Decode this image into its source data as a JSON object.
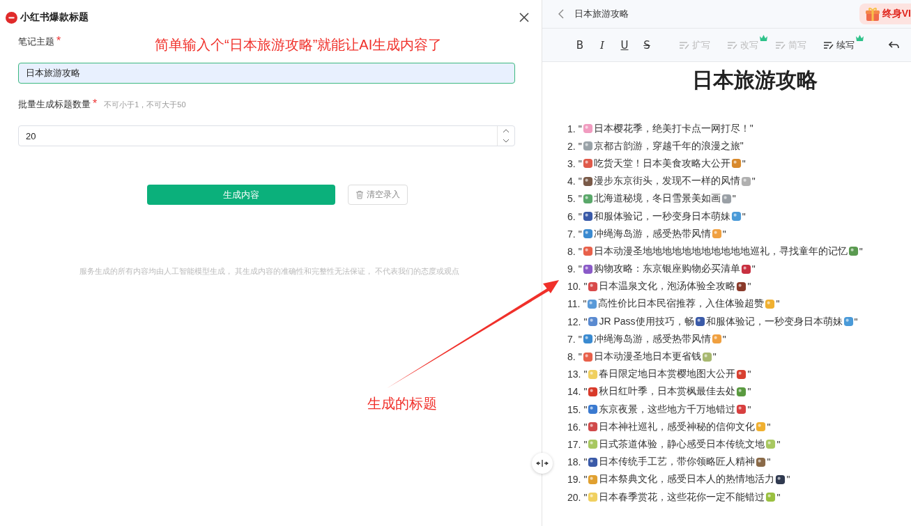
{
  "form_panel": {
    "title": "小红书爆款标题",
    "fields": [
      {
        "kind": "text",
        "label": "笔记主题",
        "required_mark": "*",
        "value": "日本旅游攻略",
        "focused": true
      },
      {
        "kind": "number",
        "label": "批量生成标题数量",
        "required_mark": "*",
        "hint": "不可小于1，不可大于50",
        "value": "20",
        "focused": false
      }
    ],
    "primary_button": "生成内容",
    "clear_button": "清空录入",
    "disclaimer": "服务生成的所有内容均由人工智能模型生成， 其生成内容的准确性和完整性无法保证， 不代表我们的态度或观点"
  },
  "annotations": [
    {
      "kind": "top",
      "text": "简单输入个“日本旅游攻略”就能让AI生成内容了"
    },
    {
      "kind": "bottom",
      "text": "生成的标题"
    }
  ],
  "editor": {
    "breadcrumb": "日本旅游攻略",
    "vip_button": "终身VI",
    "format_buttons": [
      {
        "kind": "bold",
        "label": "B"
      },
      {
        "kind": "italic",
        "label": "I"
      },
      {
        "kind": "underline",
        "label": "U"
      },
      {
        "kind": "strike",
        "label": "S"
      }
    ],
    "ai_tools": [
      {
        "label": "扩写",
        "disabled": true,
        "vip": false
      },
      {
        "label": "改写",
        "disabled": true,
        "vip": true
      },
      {
        "label": "简写",
        "disabled": true,
        "vip": false
      },
      {
        "label": "续写",
        "disabled": false,
        "vip": true
      }
    ],
    "heading": "日本旅游攻略",
    "items": [
      {
        "number": "1.",
        "parts": [
          {
            "kind": "text",
            "text": "\""
          },
          {
            "kind": "emoji",
            "color": "#f19cc0"
          },
          {
            "kind": "text",
            "text": "日本樱花季，绝美打卡点一网打尽！\""
          }
        ]
      },
      {
        "number": "2.",
        "parts": [
          {
            "kind": "text",
            "text": "\""
          },
          {
            "kind": "emoji",
            "color": "#9aa3a8"
          },
          {
            "kind": "text",
            "text": "京都古韵游，穿越千年的浪漫之旅\""
          }
        ]
      },
      {
        "number": "3.",
        "parts": [
          {
            "kind": "text",
            "text": "\""
          },
          {
            "kind": "emoji",
            "color": "#e05a4a"
          },
          {
            "kind": "text",
            "text": "吃货天堂！日本美食攻略大公开"
          },
          {
            "kind": "emoji",
            "color": "#d8892c"
          },
          {
            "kind": "text",
            "text": "\""
          }
        ]
      },
      {
        "number": "4.",
        "parts": [
          {
            "kind": "text",
            "text": "\""
          },
          {
            "kind": "emoji",
            "color": "#7a5a48"
          },
          {
            "kind": "text",
            "text": "漫步东京街头，发现不一样的风情"
          },
          {
            "kind": "emoji",
            "color": "#b0b0b0"
          },
          {
            "kind": "text",
            "text": "\""
          }
        ]
      },
      {
        "number": "5.",
        "parts": [
          {
            "kind": "text",
            "text": "\""
          },
          {
            "kind": "emoji",
            "color": "#5aa86a"
          },
          {
            "kind": "text",
            "text": "北海道秘境，冬日雪景美如画"
          },
          {
            "kind": "emoji",
            "color": "#9aa0a6"
          },
          {
            "kind": "text",
            "text": "\""
          }
        ]
      },
      {
        "number": "6.",
        "parts": [
          {
            "kind": "text",
            "text": "\""
          },
          {
            "kind": "emoji",
            "color": "#3a5aa8"
          },
          {
            "kind": "text",
            "text": "和服体验记，一秒变身日本萌妹"
          },
          {
            "kind": "emoji",
            "color": "#4a9ad8"
          },
          {
            "kind": "text",
            "text": "\""
          }
        ]
      },
      {
        "number": "7.",
        "parts": [
          {
            "kind": "text",
            "text": "\""
          },
          {
            "kind": "emoji",
            "color": "#3a8ad0"
          },
          {
            "kind": "text",
            "text": "冲绳海岛游，感受热带风情"
          },
          {
            "kind": "emoji",
            "color": "#f0a040"
          },
          {
            "kind": "text",
            "text": "\""
          }
        ]
      },
      {
        "number": "8.",
        "parts": [
          {
            "kind": "text",
            "text": "\""
          },
          {
            "kind": "emoji",
            "color": "#e8604a"
          },
          {
            "kind": "text",
            "text": "日本动漫圣地地地地地地地地地地地巡礼，寻找童年的记忆"
          },
          {
            "kind": "emoji",
            "color": "#5a9a50"
          },
          {
            "kind": "text",
            "text": "\""
          }
        ]
      },
      {
        "number": "9.",
        "parts": [
          {
            "kind": "text",
            "text": "\""
          },
          {
            "kind": "emoji",
            "color": "#8a5ac8"
          },
          {
            "kind": "text",
            "text": "购物攻略：东京银座购物必买清单"
          },
          {
            "kind": "emoji",
            "color": "#c83040"
          },
          {
            "kind": "text",
            "text": "\""
          }
        ]
      },
      {
        "number": "10.",
        "parts": [
          {
            "kind": "text",
            "text": "\""
          },
          {
            "kind": "emoji",
            "color": "#d84a4a"
          },
          {
            "kind": "text",
            "text": "日本温泉文化，泡汤体验全攻略"
          },
          {
            "kind": "emoji",
            "color": "#8a3a2a"
          },
          {
            "kind": "text",
            "text": "\""
          }
        ]
      },
      {
        "number": "11.",
        "parts": [
          {
            "kind": "text",
            "text": "\""
          },
          {
            "kind": "emoji",
            "color": "#5a9ad8"
          },
          {
            "kind": "text",
            "text": "高性价比日本民宿推荐，入住体验超赞"
          },
          {
            "kind": "emoji",
            "color": "#f0b030"
          },
          {
            "kind": "text",
            "text": "\""
          }
        ]
      },
      {
        "number": "12.",
        "parts": [
          {
            "kind": "text",
            "text": "\""
          },
          {
            "kind": "emoji",
            "color": "#5a8ad0"
          },
          {
            "kind": "text",
            "text": "JR Pass使用技巧，畅"
          },
          {
            "kind": "emoji",
            "color": "#3a5aa8"
          },
          {
            "kind": "text",
            "text": "和服体验记，一秒变身日本萌妹"
          },
          {
            "kind": "emoji",
            "color": "#4a9ad8"
          },
          {
            "kind": "text",
            "text": "\""
          }
        ]
      },
      {
        "number": "7.",
        "parts": [
          {
            "kind": "text",
            "text": "\""
          },
          {
            "kind": "emoji",
            "color": "#3a8ad0"
          },
          {
            "kind": "text",
            "text": "冲绳海岛游，感受热带风情"
          },
          {
            "kind": "emoji",
            "color": "#f0a040"
          },
          {
            "kind": "text",
            "text": "\""
          }
        ]
      },
      {
        "number": "8.",
        "parts": [
          {
            "kind": "text",
            "text": "\""
          },
          {
            "kind": "emoji",
            "color": "#e8604a"
          },
          {
            "kind": "text",
            "text": "日本动漫圣地日本更省钱"
          },
          {
            "kind": "emoji",
            "color": "#a8b870"
          },
          {
            "kind": "text",
            "text": "\""
          }
        ]
      },
      {
        "number": "13.",
        "parts": [
          {
            "kind": "text",
            "text": "\""
          },
          {
            "kind": "emoji",
            "color": "#f0d060"
          },
          {
            "kind": "text",
            "text": "春日限定地日本赏樱地图大公开"
          },
          {
            "kind": "emoji",
            "color": "#d84030"
          },
          {
            "kind": "text",
            "text": "\""
          }
        ]
      },
      {
        "number": "14.",
        "parts": [
          {
            "kind": "text",
            "text": "\""
          },
          {
            "kind": "emoji",
            "color": "#d83a2a"
          },
          {
            "kind": "text",
            "text": "秋日红叶季，日本赏枫最佳去处"
          },
          {
            "kind": "emoji",
            "color": "#5a9a40"
          },
          {
            "kind": "text",
            "text": "\""
          }
        ]
      },
      {
        "number": "15.",
        "parts": [
          {
            "kind": "text",
            "text": "\""
          },
          {
            "kind": "emoji",
            "color": "#3a7ad0"
          },
          {
            "kind": "text",
            "text": "东京夜景，这些地方千万地错过"
          },
          {
            "kind": "emoji",
            "color": "#d84040"
          },
          {
            "kind": "text",
            "text": "\""
          }
        ]
      },
      {
        "number": "16.",
        "parts": [
          {
            "kind": "text",
            "text": "\""
          },
          {
            "kind": "emoji",
            "color": "#d04a4a"
          },
          {
            "kind": "text",
            "text": "日本神社巡礼，感受神秘的信仰文化"
          },
          {
            "kind": "emoji",
            "color": "#f0b030"
          },
          {
            "kind": "text",
            "text": "\""
          }
        ]
      },
      {
        "number": "17.",
        "parts": [
          {
            "kind": "text",
            "text": "\""
          },
          {
            "kind": "emoji",
            "color": "#a8c860"
          },
          {
            "kind": "text",
            "text": "日式茶道体验，静心感受日本传统文地"
          },
          {
            "kind": "emoji",
            "color": "#a8c860"
          },
          {
            "kind": "text",
            "text": "\""
          }
        ]
      },
      {
        "number": "18.",
        "parts": [
          {
            "kind": "text",
            "text": "\""
          },
          {
            "kind": "emoji",
            "color": "#3a5aa8"
          },
          {
            "kind": "text",
            "text": "日本传统手工艺，带你领略匠人精神"
          },
          {
            "kind": "emoji",
            "color": "#8a6a48"
          },
          {
            "kind": "text",
            "text": "\""
          }
        ]
      },
      {
        "number": "19.",
        "parts": [
          {
            "kind": "text",
            "text": "\""
          },
          {
            "kind": "emoji",
            "color": "#e0a030"
          },
          {
            "kind": "text",
            "text": "日本祭典文化，感受日本人的热情地活力"
          },
          {
            "kind": "emoji",
            "color": "#303a50"
          },
          {
            "kind": "text",
            "text": "\""
          }
        ]
      },
      {
        "number": "20.",
        "parts": [
          {
            "kind": "text",
            "text": "\""
          },
          {
            "kind": "emoji",
            "color": "#f0d060"
          },
          {
            "kind": "text",
            "text": "日本春季赏花，这些花你一定不能错过"
          },
          {
            "kind": "emoji",
            "color": "#9ac040"
          },
          {
            "kind": "text",
            "text": "\""
          }
        ]
      }
    ]
  }
}
